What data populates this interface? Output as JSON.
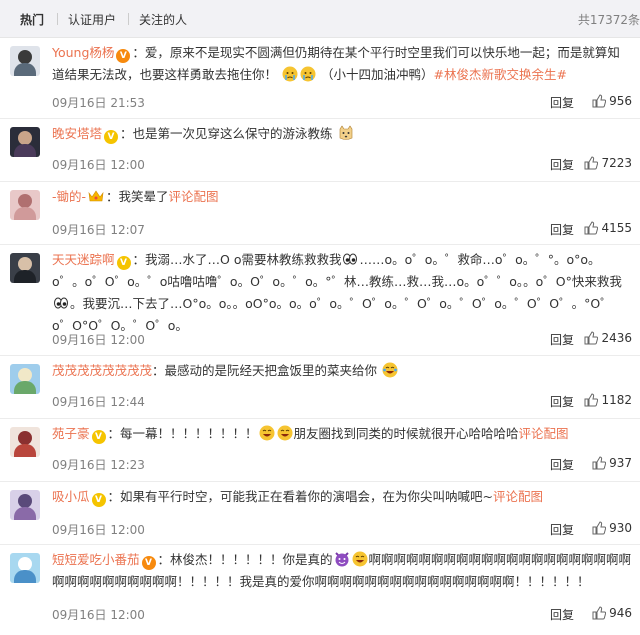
{
  "tabs": [
    "热门",
    "认证用户",
    "关注的人"
  ],
  "total_comments": "共17372条",
  "reply_label": "回复",
  "topic_text": "#林俊杰新歌交换余生#",
  "pic_link": "评论配图",
  "comments": [
    {
      "user": "Young杨杨",
      "badge": "v-red",
      "text": "：爱，原来不是现实不圆满但仍期待在某个平行时空里我们可以快乐地一起；而是就算知道结果无法改，也要这样勇敢去拖住你！",
      "tail": "（小十四加油冲鸭）",
      "date": "09月16日 21:53",
      "likes": "956"
    },
    {
      "user": "晚安塔塔",
      "badge": "v-yellow",
      "text": "：也是第一次见穿这么保守的游泳教练",
      "date": "09月16日 12:00",
      "likes": "7223"
    },
    {
      "user": "-锄的-",
      "badge": "crown",
      "text": "：我笑晕了",
      "date": "09月16日 12:07",
      "likes": "4155"
    },
    {
      "user": "天天迷踪啊",
      "badge": "v-yellow",
      "text": "：我溺…水了…O o需要林教练救救我",
      "text2": "……o。o゜o。゜救命…o゜o。゜°。o°o。o゜。o゜O゜o。゜o咕噜咕噜゜o。O゜o。゜o。°゜林…教练…救…我…o。o゜゜o。。o゜O°快来救我",
      "text3": "。我要沉…下去了…O°o。o。。oO°o。o。o゜o。゜O゜o。゜O゜o。゜O゜o。゜O゜O゜。°O゜o゜O°O゜O。゜O゜o。",
      "date": "09月16日 12:00",
      "likes": "2436"
    },
    {
      "user": "茂茂茂茂茂茂茂茂",
      "badge": "",
      "text": "：最感动的是阮经天把盒饭里的菜夹给你",
      "date": "09月16日 12:44",
      "likes": "1182"
    },
    {
      "user": "苑子豪",
      "badge": "v-yellow",
      "text": "：每一幕！！！！！！！！",
      "text2": "朋友圈找到同类的时候就很开心哈哈哈哈",
      "date": "09月16日 12:23",
      "likes": "937"
    },
    {
      "user": "吸小瓜",
      "badge": "v-yellow",
      "text": "：如果有平行时空，可能我正在看着你的演唱会，在为你尖叫呐喊吧~",
      "date": "09月16日 12:00",
      "likes": "930"
    },
    {
      "user": "短短爱吃小番茄",
      "badge": "v-red",
      "text": "：林俊杰！！！！！！你是真的",
      "text2": "啊啊啊啊啊啊啊啊啊啊啊啊啊啊啊啊啊啊啊啊啊啊啊啊啊啊啊啊啊啊啊！！！！！我是真的爱你啊啊啊啊啊啊啊啊啊啊啊啊啊啊啊啊！！！！！！",
      "date": "09月16日 12:00",
      "likes": "946"
    }
  ],
  "colors": {
    "accent": "#eb7350",
    "tab_bg": "#f2f2f5",
    "meta": "#808080"
  }
}
